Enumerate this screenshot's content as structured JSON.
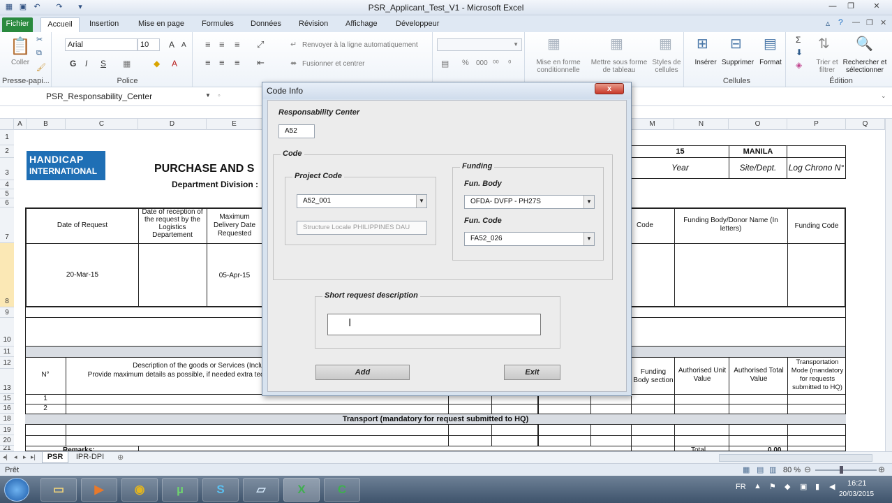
{
  "window": {
    "title": "PSR_Applicant_Test_V1  -  Microsoft Excel"
  },
  "ribbon": {
    "tabs": [
      "Fichier",
      "Accueil",
      "Insertion",
      "Mise en page",
      "Formules",
      "Données",
      "Révision",
      "Affichage",
      "Développeur"
    ],
    "clipboard": {
      "paste": "Coller",
      "group": "Presse-papi..."
    },
    "font": {
      "name": "Arial",
      "size": "10",
      "bold": "G",
      "italic": "I",
      "underline": "S",
      "group": "Police"
    },
    "alignment": {
      "wrap": "Renvoyer à la ligne automatiquement",
      "merge": "Fusionner et centrer"
    },
    "number": {
      "percent": "%",
      "thousands": "000"
    },
    "styles": {
      "conditional": "Mise en forme conditionnelle",
      "table": "Mettre sous forme de tableau",
      "cell": "Styles de cellules"
    },
    "cells": {
      "insert": "Insérer",
      "delete": "Supprimer",
      "format": "Format",
      "group": "Cellules"
    },
    "editing": {
      "sort": "Trier et filtrer",
      "find": "Rechercher et sélectionner",
      "group": "Édition"
    }
  },
  "formula_bar": {
    "name_box": "PSR_Responsability_Center"
  },
  "columns": [
    "A",
    "B",
    "C",
    "D",
    "E",
    "M",
    "N",
    "O",
    "P",
    "Q"
  ],
  "rows": [
    "1",
    "2",
    "3",
    "4",
    "5",
    "6",
    "7",
    "8",
    "9",
    "10",
    "11",
    "12",
    "13",
    "15",
    "16",
    "18",
    "19",
    "20",
    "21"
  ],
  "sheet": {
    "logo_line1": "HANDICAP",
    "logo_line2": "INTERNATIONAL",
    "title_partial": "PURCHASE AND S",
    "dept_partial": "Department Division :",
    "year_value": "15",
    "site_value": "MANILA",
    "year_label": "Year",
    "site_label": "Site/Dept.",
    "chrono_label": "Log Chrono N°",
    "date_request_hdr": "Date of Request",
    "date_reception_hdr": "Date of reception of the request by the Logistics Departement",
    "max_delivery_hdr": "Maximum Delivery Date Requested",
    "code_hdr_partial": "Code",
    "funding_name_hdr": "Funding Body/Donor Name (In letters)",
    "funding_code_hdr": "Funding Code",
    "date_request_val": "20-Mar-15",
    "max_delivery_val": "05-Apr-15",
    "n_hdr": "N°",
    "desc_hdr_line1": "Description of the goods or Services (Inclu",
    "desc_hdr_line2": "Provide maximum details as possible, if needed extra tec",
    "funding_section_hdr": "Funding Body section",
    "unit_value_hdr": "Authorised Unit Value",
    "total_value_hdr": "Authorised Total Value",
    "transport_mode_hdr": "Transportation Mode (mandatory for requests submitted to HQ)",
    "row1": "1",
    "row2": "2",
    "transport_banner": "Transport (mandatory for request submitted to HQ)",
    "remarks": "Remarks:",
    "total": "Total",
    "total_value": "0.00"
  },
  "dialog": {
    "title": "Code Info",
    "close": "x",
    "resp_center_label": "Responsability Center",
    "resp_center_value": "A52",
    "code_frame": "Code",
    "project_frame": "Project Code",
    "project_value": "A52_001",
    "project_desc": "Structure Locale PHILIPPINES DAU",
    "funding_frame": "Funding",
    "fun_body_label": "Fun. Body",
    "fun_body_value": "OFDA-  DVFP - PH27S",
    "fun_code_label": "Fun. Code",
    "fun_code_value": "FA52_026",
    "short_desc_frame": "Short request description",
    "short_desc_value": "",
    "add_button": "Add",
    "exit_button": "Exit"
  },
  "sheet_tabs": [
    "PSR",
    "IPR-DPI"
  ],
  "status": {
    "ready": "Prêt",
    "zoom": "80 %"
  },
  "taskbar": {
    "lang": "FR",
    "time": "16:21",
    "date": "20/03/2015"
  }
}
